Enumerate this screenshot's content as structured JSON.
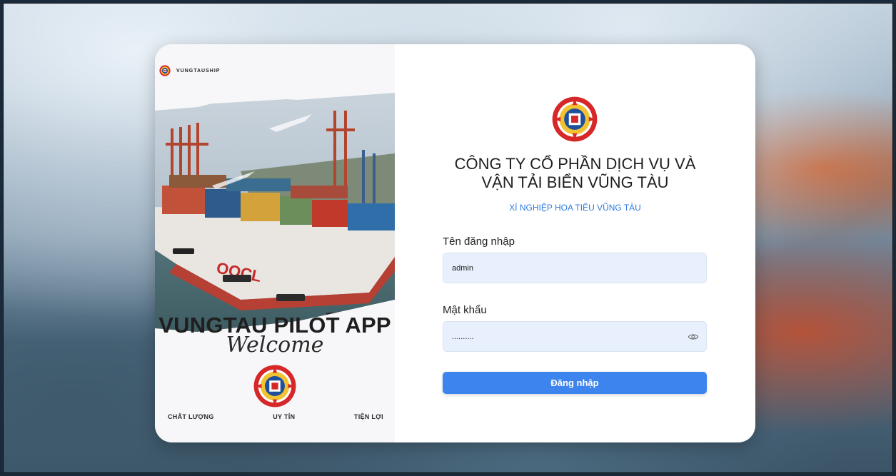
{
  "brand": {
    "name": "VUNGTAUSHIP"
  },
  "left_panel": {
    "app_title": "VUNGTAU PILOT APP",
    "welcome": "Welcome",
    "tags": [
      "CHẤT LƯỢNG",
      "UY TÍN",
      "TIỆN LỢI"
    ],
    "ship_name": "OOCL"
  },
  "company": {
    "line1": "CÔNG TY CỔ PHẦN DỊCH VỤ VÀ",
    "line2": "VẬN TẢI BIỂN VŨNG TÀU",
    "unit": "XÍ NGHIỆP HOA TIÊU VŨNG TÀU"
  },
  "form": {
    "username_label": "Tên đăng nhập",
    "username_value": "admin",
    "password_label": "Mật khẩu",
    "password_value": "..........",
    "submit_label": "Đăng nhập"
  },
  "colors": {
    "accent": "#3d84ee",
    "input_bg": "#e8f0fd",
    "unit_text": "#2f7be0"
  },
  "icons": [
    "logo-icon",
    "eye-icon"
  ]
}
